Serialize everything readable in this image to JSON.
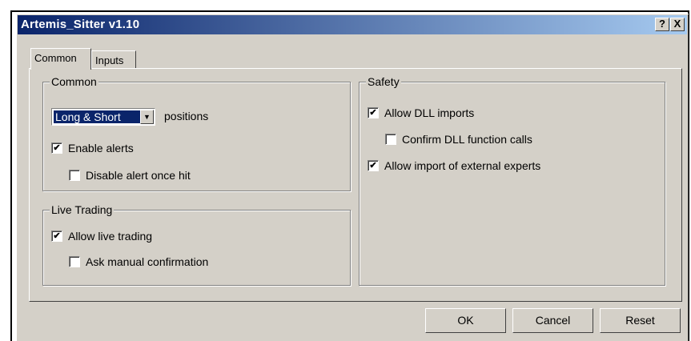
{
  "window": {
    "title": "Artemis_Sitter v1.10",
    "help_glyph": "?",
    "close_glyph": "X"
  },
  "tabs": [
    {
      "label": "Common"
    },
    {
      "label": "Inputs"
    }
  ],
  "common_group": {
    "legend": "Common",
    "positions_select": {
      "value": "Long & Short",
      "suffix": "positions"
    },
    "enable_alerts": {
      "label": "Enable alerts",
      "checked": true
    },
    "disable_alert": {
      "label": "Disable alert once hit",
      "checked": false
    }
  },
  "live_group": {
    "legend": "Live Trading",
    "allow_live": {
      "label": "Allow live trading",
      "checked": true
    },
    "ask_manual": {
      "label": "Ask manual confirmation",
      "checked": false
    }
  },
  "safety_group": {
    "legend": "Safety",
    "allow_dll": {
      "label": "Allow DLL imports",
      "checked": true
    },
    "confirm_dll": {
      "label": "Confirm DLL function calls",
      "checked": false
    },
    "allow_external": {
      "label": "Allow import of external experts",
      "checked": true
    }
  },
  "buttons": {
    "ok": "OK",
    "cancel": "Cancel",
    "reset": "Reset"
  },
  "check_mark": "✔"
}
